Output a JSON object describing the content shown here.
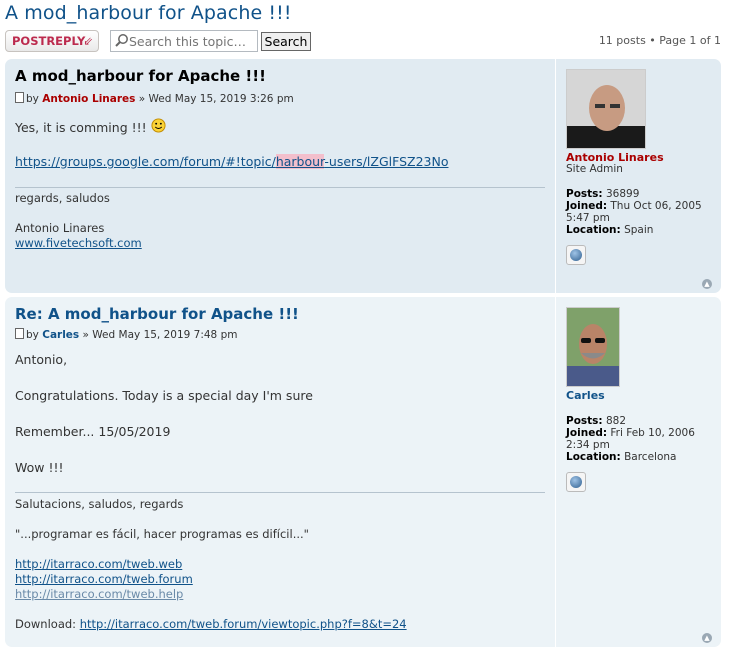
{
  "topic": {
    "title": "A mod_harbour for Apache !!!",
    "post_reply_label": "POSTREPLY",
    "search_placeholder": "Search this topic…",
    "search_button": "Search",
    "pagination": "11 posts • Page 1 of 1"
  },
  "posts": [
    {
      "title": "A mod_harbour for Apache !!!",
      "by": "by",
      "author": "Antonio Linares",
      "date": "» Wed May 15, 2019 3:26 pm",
      "body_line1": "Yes, it is comming !!!",
      "link_pre": "https://groups.google.com/forum/#!topic/",
      "link_hl": "harbour",
      "link_post": "-users/lZGlFSZ23No",
      "sig_line1": "regards, saludos",
      "sig_line2": "Antonio Linares",
      "sig_link": "www.fivetechsoft.com",
      "profile": {
        "name": "Antonio Linares",
        "rank": "Site Admin",
        "posts_label": "Posts:",
        "posts": "36899",
        "joined_label": "Joined:",
        "joined_1": "Thu Oct 06, 2005",
        "joined_2": "5:47 pm",
        "location_label": "Location:",
        "location": "Spain"
      }
    },
    {
      "title": "Re: A mod_harbour for Apache !!!",
      "by": "by",
      "author": "Carles",
      "date": "» Wed May 15, 2019 7:48 pm",
      "body_line1": "Antonio,",
      "body_line2": "Congratulations. Today is a special day I'm sure",
      "body_line3": "Remember... 15/05/2019",
      "body_line4": "Wow !!!",
      "sig_line1": "Salutacions, saludos, regards",
      "sig_line2": "\"...programar es fácil, hacer programas es difícil...\"",
      "sig_links": [
        "http://itarraco.com/tweb.web",
        "http://itarraco.com/tweb.forum",
        "http://itarraco.com/tweb.help"
      ],
      "download_label": "Download:",
      "download_link": "http://itarraco.com/tweb.forum/viewtopic.php?f=8&t=24",
      "profile": {
        "name": "Carles",
        "posts_label": "Posts:",
        "posts": "882",
        "joined_label": "Joined:",
        "joined_1": "Fri Feb 10, 2006",
        "joined_2": "2:34 pm",
        "location_label": "Location:",
        "location": "Barcelona"
      }
    }
  ]
}
